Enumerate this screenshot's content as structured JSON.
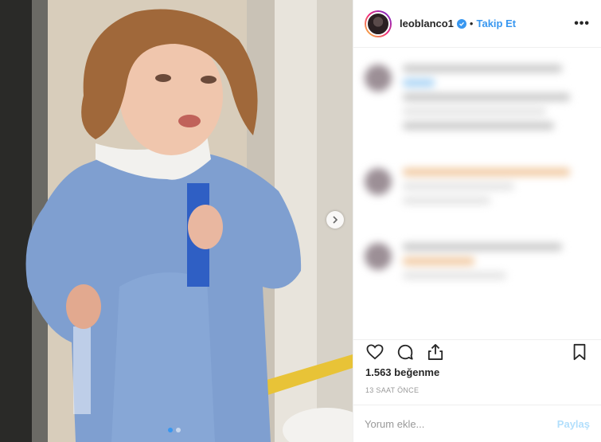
{
  "header": {
    "username": "leoblanco1",
    "separator": "•",
    "follow_label": "Takip Et",
    "more_label": "•••"
  },
  "post": {
    "likes_text": "1.563 beğenme",
    "time_text": "13 SAAT ÖNCE"
  },
  "comment_box": {
    "placeholder": "Yorum ekle...",
    "post_label": "Paylaş"
  },
  "carousel": {
    "slide_count": 2,
    "active_index": 0
  },
  "icons": {
    "next": "chevron-right-icon",
    "like": "heart-icon",
    "comment": "comment-bubble-icon",
    "share": "share-icon",
    "save": "bookmark-icon",
    "verified": "verified-badge-icon"
  },
  "colors": {
    "accent": "#3897f0",
    "text": "#262626",
    "muted": "#999999"
  }
}
